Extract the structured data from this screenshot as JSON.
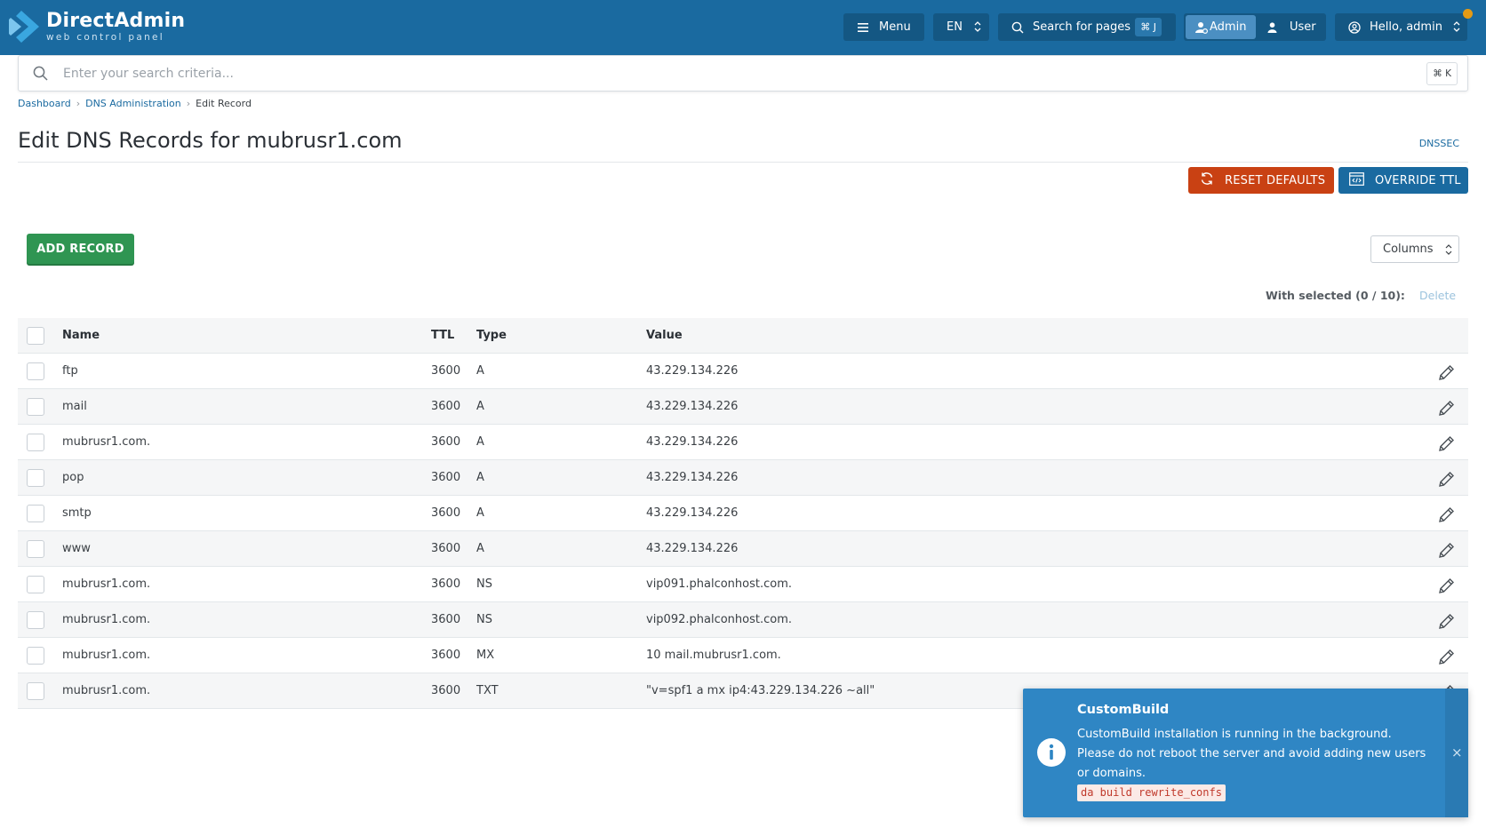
{
  "brand": {
    "name": "DirectAdmin",
    "tagline": "web control panel"
  },
  "topbar": {
    "menu_label": "Menu",
    "lang_label": "EN",
    "search_pages_label": "Search for pages",
    "search_pages_shortcut": "⌘ J",
    "role_admin_label": "Admin",
    "role_user_label": "User",
    "greeting": "Hello, admin"
  },
  "search": {
    "placeholder": "Enter your search criteria...",
    "shortcut": "⌘ K"
  },
  "breadcrumb": {
    "items": [
      "Dashboard",
      "DNS Administration"
    ],
    "current": "Edit Record"
  },
  "page": {
    "title": "Edit DNS Records for mubrusr1.com",
    "dnssec_label": "DNSSEC",
    "reset_label": "RESET DEFAULTS",
    "override_label": "OVERRIDE TTL",
    "add_label": "ADD RECORD",
    "columns_label": "Columns",
    "with_selected": "With selected (0 / 10):",
    "delete_label": "Delete"
  },
  "table": {
    "headers": {
      "name": "Name",
      "ttl": "TTL",
      "type": "Type",
      "value": "Value"
    },
    "rows": [
      {
        "name": "ftp",
        "ttl": "3600",
        "type": "A",
        "value": "43.229.134.226"
      },
      {
        "name": "mail",
        "ttl": "3600",
        "type": "A",
        "value": "43.229.134.226"
      },
      {
        "name": "mubrusr1.com.",
        "ttl": "3600",
        "type": "A",
        "value": "43.229.134.226"
      },
      {
        "name": "pop",
        "ttl": "3600",
        "type": "A",
        "value": "43.229.134.226"
      },
      {
        "name": "smtp",
        "ttl": "3600",
        "type": "A",
        "value": "43.229.134.226"
      },
      {
        "name": "www",
        "ttl": "3600",
        "type": "A",
        "value": "43.229.134.226"
      },
      {
        "name": "mubrusr1.com.",
        "ttl": "3600",
        "type": "NS",
        "value": "vip091.phalconhost.com."
      },
      {
        "name": "mubrusr1.com.",
        "ttl": "3600",
        "type": "NS",
        "value": "vip092.phalconhost.com."
      },
      {
        "name": "mubrusr1.com.",
        "ttl": "3600",
        "type": "MX",
        "value": "10 mail.mubrusr1.com."
      },
      {
        "name": "mubrusr1.com.",
        "ttl": "3600",
        "type": "TXT",
        "value": "\"v=spf1 a mx ip4:43.229.134.226 ~all\""
      }
    ]
  },
  "toast": {
    "title": "CustomBuild",
    "message": "CustomBuild installation is running in the background. Please do not reboot the server and avoid adding new users or domains.",
    "code": "da build rewrite_confs",
    "close_symbol": "×"
  },
  "icons": {
    "menu": "hamburger-icon",
    "lang": "chevron-updown-icon",
    "search": "search-icon",
    "admin": "admin-user-icon",
    "user": "user-icon",
    "account": "account-circle-icon",
    "reset": "refresh-icon",
    "override": "code-window-icon",
    "edit": "pencil-icon",
    "info": "info-icon"
  },
  "colors": {
    "topbar": "#1a6aa0",
    "primary": "#1a6aa0",
    "danger": "#c94113",
    "success": "#2f9552",
    "toast": "#2f86c4",
    "notification": "#e59a14"
  }
}
